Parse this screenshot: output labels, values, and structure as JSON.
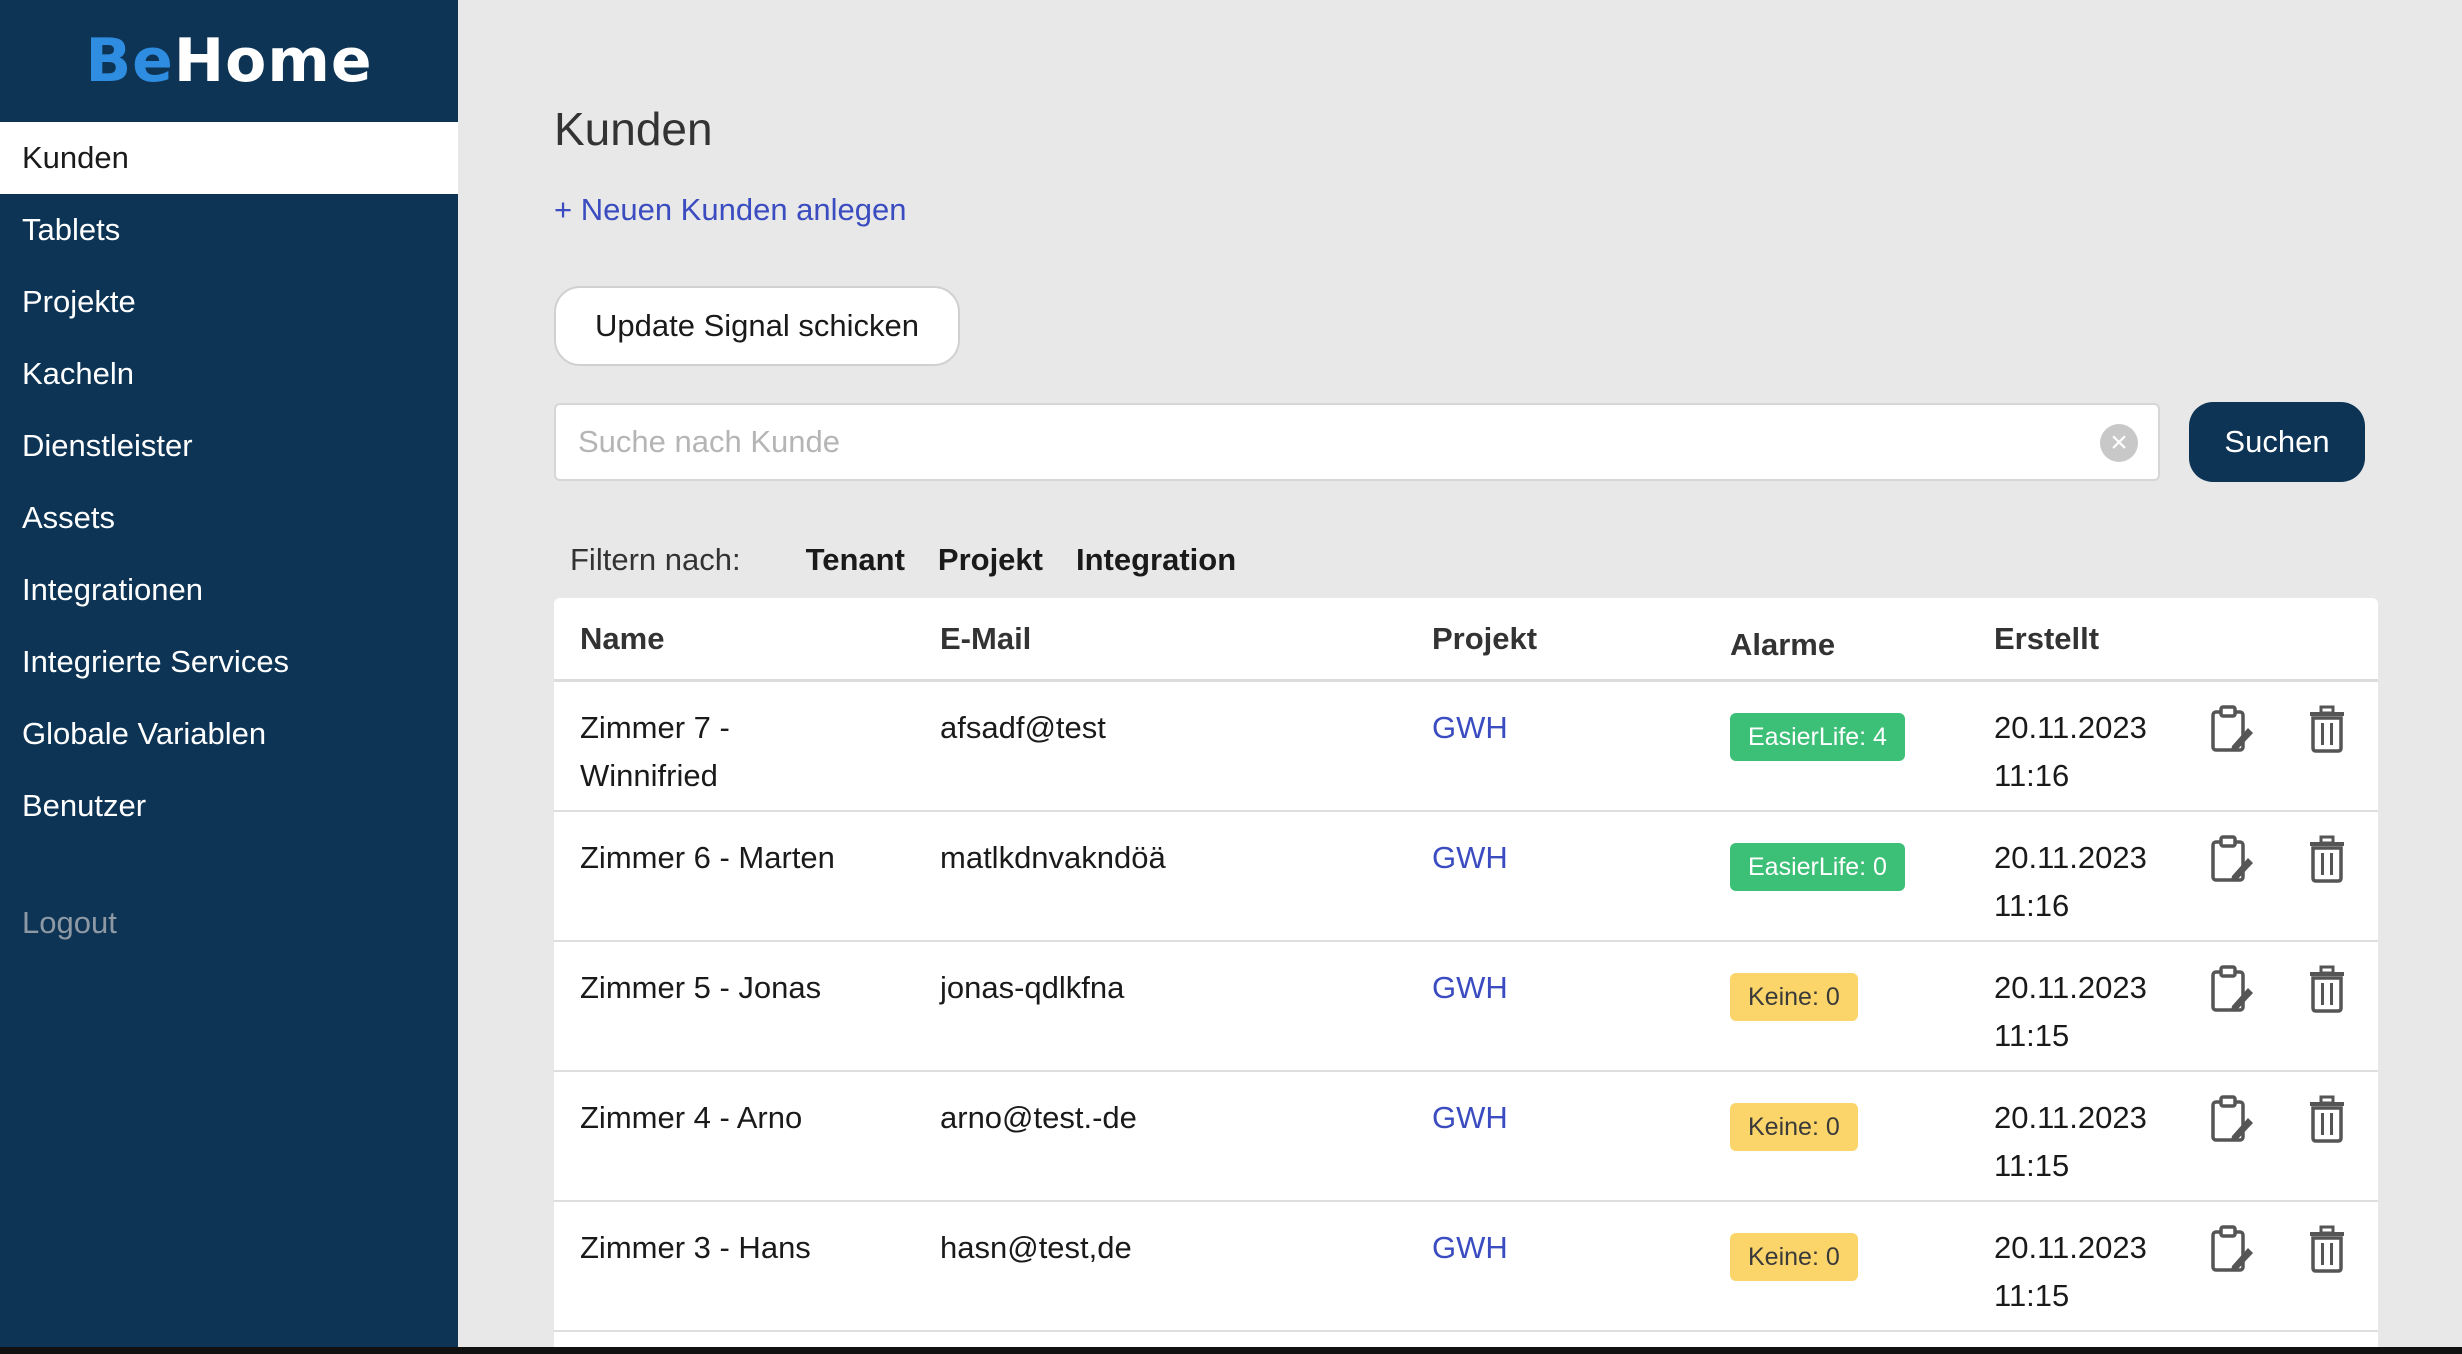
{
  "brand": {
    "part1": "Be",
    "part2": "Home"
  },
  "sidebar": {
    "items": [
      {
        "label": "Kunden",
        "active": true
      },
      {
        "label": "Tablets"
      },
      {
        "label": "Projekte"
      },
      {
        "label": "Kacheln"
      },
      {
        "label": "Dienstleister"
      },
      {
        "label": "Assets"
      },
      {
        "label": "Integrationen"
      },
      {
        "label": "Integrierte Services"
      },
      {
        "label": "Globale Variablen"
      },
      {
        "label": "Benutzer"
      }
    ],
    "logout": "Logout"
  },
  "main": {
    "title": "Kunden",
    "new_link": "+ Neuen Kunden anlegen",
    "update_button": "Update Signal schicken",
    "search": {
      "placeholder": "Suche nach Kunde",
      "value": "",
      "button": "Suchen"
    },
    "filter": {
      "label": "Filtern nach:",
      "options": [
        "Tenant",
        "Projekt",
        "Integration"
      ]
    },
    "table": {
      "headers": [
        "Name",
        "E-Mail",
        "Projekt",
        "Alarme",
        "Erstellt"
      ],
      "rows": [
        {
          "name_l1": "Zimmer 7 -",
          "name_l2": "Winnifried",
          "email": "afsadf@test",
          "project": "GWH",
          "alarm": "EasierLife: 4",
          "alarm_type": "green",
          "date": "20.11.2023",
          "time": "11:16"
        },
        {
          "name_l1": "Zimmer 6 - Marten",
          "name_l2": "",
          "email": "matlkdnvakndöä",
          "project": "GWH",
          "alarm": "EasierLife: 0",
          "alarm_type": "green",
          "date": "20.11.2023",
          "time": "11:16"
        },
        {
          "name_l1": "Zimmer 5 - Jonas",
          "name_l2": "",
          "email": "jonas-qdlkfna",
          "project": "GWH",
          "alarm": "Keine: 0",
          "alarm_type": "yellow",
          "date": "20.11.2023",
          "time": "11:15"
        },
        {
          "name_l1": "Zimmer 4 - Arno",
          "name_l2": "",
          "email": "arno@test.-de",
          "project": "GWH",
          "alarm": "Keine: 0",
          "alarm_type": "yellow",
          "date": "20.11.2023",
          "time": "11:15"
        },
        {
          "name_l1": "Zimmer 3 - Hans",
          "name_l2": "",
          "email": "hasn@test,de",
          "project": "GWH",
          "alarm": "Keine: 0",
          "alarm_type": "yellow",
          "date": "20.11.2023",
          "time": "11:15"
        }
      ]
    }
  },
  "icons": {
    "edit": "clipboard-edit-icon",
    "delete": "trash-icon",
    "clear": "clear-circle-icon"
  },
  "colors": {
    "sidebar": "#0d3455",
    "accent_link": "#3a4cc0",
    "badge_green": "#3cbf76",
    "badge_yellow": "#fbd56a",
    "logo_blue": "#2e8de0"
  }
}
